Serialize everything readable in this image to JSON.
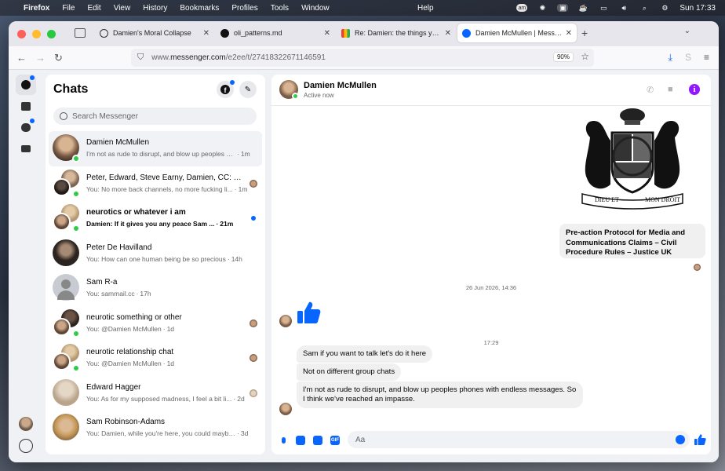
{
  "menubar": {
    "app": "Firefox",
    "menus": [
      "File",
      "Edit",
      "View",
      "History",
      "Bookmarks",
      "Profiles",
      "Tools",
      "Window"
    ],
    "help": "Help",
    "clock": "Sun 17:33",
    "badge": "am"
  },
  "tabs": [
    {
      "title": "Damien's Moral Collapse",
      "icon": "chatgpt-icon"
    },
    {
      "title": "oli_patterns.md",
      "icon": "github-icon"
    },
    {
      "title": "Re: Damien: the things you are s",
      "icon": "gmail-icon"
    },
    {
      "title": "Damien McMullen | Messenger",
      "icon": "messenger-icon",
      "active": true
    }
  ],
  "address": {
    "host": "www.",
    "domain": "messenger.com",
    "path": "/e2ee/t/27418322671146591",
    "zoom": "90%"
  },
  "chats": {
    "title": "Chats",
    "search_placeholder": "Search Messenger",
    "items": [
      {
        "name": "Damien McMullen",
        "preview": "I'm not as rude to disrupt, and blow up peoples ph...",
        "time": "1m",
        "online": true,
        "selected": true
      },
      {
        "name": "Peter, Edward, Steve Earny, Damien, CC: M...",
        "preview": "You: No more back channels, no more fucking li...",
        "time": "1m",
        "online": true,
        "seen": true
      },
      {
        "name": "neurotics or whatever i am",
        "preview": "Damien: If it gives you any peace Sam ...",
        "time": "21m",
        "online": true,
        "unread": true
      },
      {
        "name": "Peter De Havilland",
        "preview": "You: How can one human being be so precious",
        "time": "14h"
      },
      {
        "name": "Sam R-a",
        "preview": "You: sammail.cc",
        "time": "17h"
      },
      {
        "name": "neurotic something or other",
        "preview": "You: @Damien McMullen",
        "time": "1d",
        "online": true,
        "seen": true
      },
      {
        "name": "neurotic relationship chat",
        "preview": "You: @Damien McMullen",
        "time": "1d",
        "online": true,
        "seen": true
      },
      {
        "name": "Edward Hagger",
        "preview": "You: As for my supposed madness, I feel a bit li...",
        "time": "2d",
        "seen": true
      },
      {
        "name": "Sam Robinson-Adams",
        "preview": "You: Damien, while you're here, you could maybe: ...",
        "time": "3d"
      }
    ]
  },
  "conversation": {
    "name": "Damien McMullen",
    "status": "Active now",
    "link_card": "Pre-action Protocol for Media and Communications Claims – Civil Procedure Rules – Justice UK",
    "coat_motto_left": "DIEU ET",
    "coat_motto_right": "MON DROIT",
    "timestamp1": "26 Jun 2026, 14:36",
    "timestamp2": "17:29",
    "messages": [
      "Sam if you want to talk let's do it here",
      "Not on different group chats",
      "I'm not as rude to disrupt, and blow up peoples phones with endless messages. So I think we've reached an impasse."
    ],
    "composer_placeholder": "Aa",
    "gif_label": "GIF"
  },
  "colors": {
    "accent": "#0866ff",
    "online": "#31cc46",
    "info": "#9317ff"
  }
}
